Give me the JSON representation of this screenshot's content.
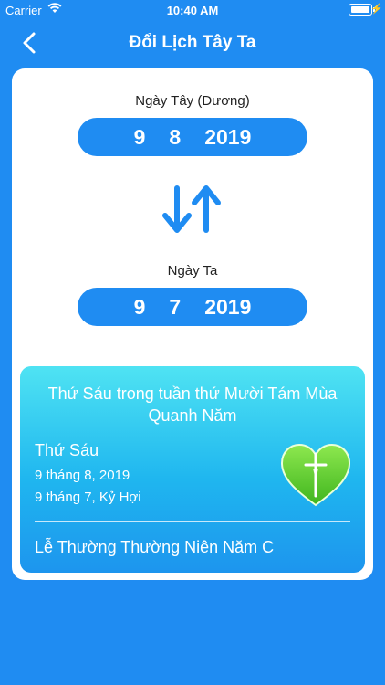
{
  "status_bar": {
    "carrier": "Carrier",
    "time": "10:40 AM"
  },
  "nav": {
    "title": "Đổi Lịch Tây Ta",
    "back_icon": "chevron-left-icon"
  },
  "solar": {
    "label": "Ngày Tây (Dương)",
    "day": "9",
    "month": "8",
    "year": "2019"
  },
  "swap_icon": "swap-arrows-icon",
  "lunar": {
    "label": "Ngày Ta",
    "day": "9",
    "month": "7",
    "year": "2019"
  },
  "info": {
    "title": "Thứ Sáu trong tuần thứ Mười Tám Mùa Quanh Năm",
    "weekday": "Thứ Sáu",
    "solar_date": "9 tháng 8, 2019",
    "lunar_date": "9 tháng 7, Kỷ Hợi",
    "feast": "Lễ Thường Thường Niên Năm C",
    "icon": "heart-crucifix-icon"
  },
  "colors": {
    "background": "#1f8cf2",
    "card": "#ffffff",
    "heart": "#5fd32b"
  }
}
